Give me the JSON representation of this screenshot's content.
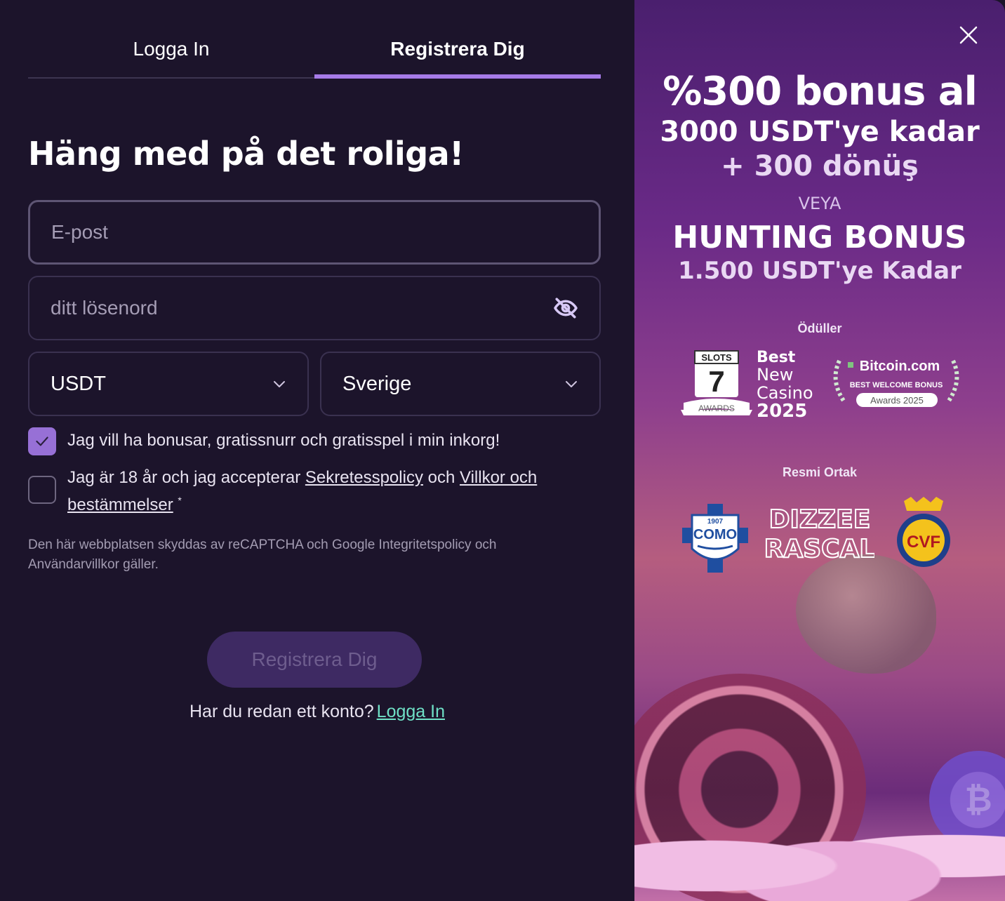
{
  "tabs": {
    "login": "Logga In",
    "register": "Registrera Dig"
  },
  "form": {
    "heading": "Häng med på det roliga!",
    "email_placeholder": "E-post",
    "password_placeholder": "ditt lösenord",
    "currency_value": "USDT",
    "country_value": "Sverige",
    "bonus_opt_in": {
      "label": "Jag vill ha bonusar, gratissnurr och gratisspel i min inkorg!",
      "checked": true
    },
    "terms": {
      "prefix": "Jag är 18 år och jag accepterar",
      "privacy_link": "Sekretesspolicy",
      "middle": "och",
      "terms_link": "Villkor och bestämmelser",
      "asterisk": "*",
      "checked": false
    },
    "recaptcha_notice": "Den här webbplatsen skyddas av reCAPTCHA och Google Integritetspolicy och Användarvillkor gäller.",
    "submit_label": "Registrera Dig",
    "have_account_text": "Har du redan ett konto?",
    "login_link": "Logga In"
  },
  "promo": {
    "line1": "%300 bonus al",
    "line2": "3000 USDT'ye kadar",
    "line3": "+ 300 dönüş",
    "line4": "VEYA",
    "line5": "HUNTING BONUS",
    "line6": "1.500 USDT'ye Kadar",
    "awards_label": "Ödüller",
    "award1": {
      "badge_top": "SLOTS",
      "badge_number": "7",
      "badge_bottom": "AWARDS",
      "text_line1": "Best",
      "text_line2": "New",
      "text_line3": "Casino",
      "year": "2025"
    },
    "award2": {
      "brand": "Bitcoin.com",
      "title": "BEST WELCOME BONUS",
      "subtitle": "Awards 2025"
    },
    "partners_label": "Resmi Ortak",
    "partner1": {
      "year": "1907",
      "name": "COMO"
    },
    "partner2": {
      "line1": "DIZZEE",
      "line2": "RASCAL"
    },
    "partner3": {
      "name": "CVF"
    },
    "chip_symbol": "₿"
  },
  "colors": {
    "accent": "#a67be8",
    "link_green": "#6fe0c6",
    "bg": "#1c142b"
  }
}
